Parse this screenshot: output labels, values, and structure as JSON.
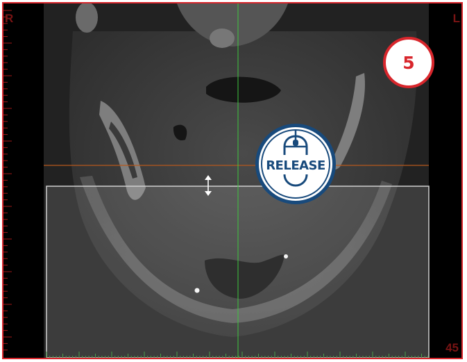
{
  "viewer": {
    "orientation_right": "R",
    "orientation_left": "L",
    "slice_number": "45"
  },
  "step": {
    "number": "5"
  },
  "release": {
    "label": "RELEASE",
    "icon": "mouse-icon"
  },
  "colors": {
    "frame": "#d8262c",
    "badge_blue": "#184a7c",
    "crosshair_green": "#3ec83e",
    "reference_line": "#b8581c",
    "ruler_red": "#a01818",
    "ruler_green": "#4aa04a"
  }
}
